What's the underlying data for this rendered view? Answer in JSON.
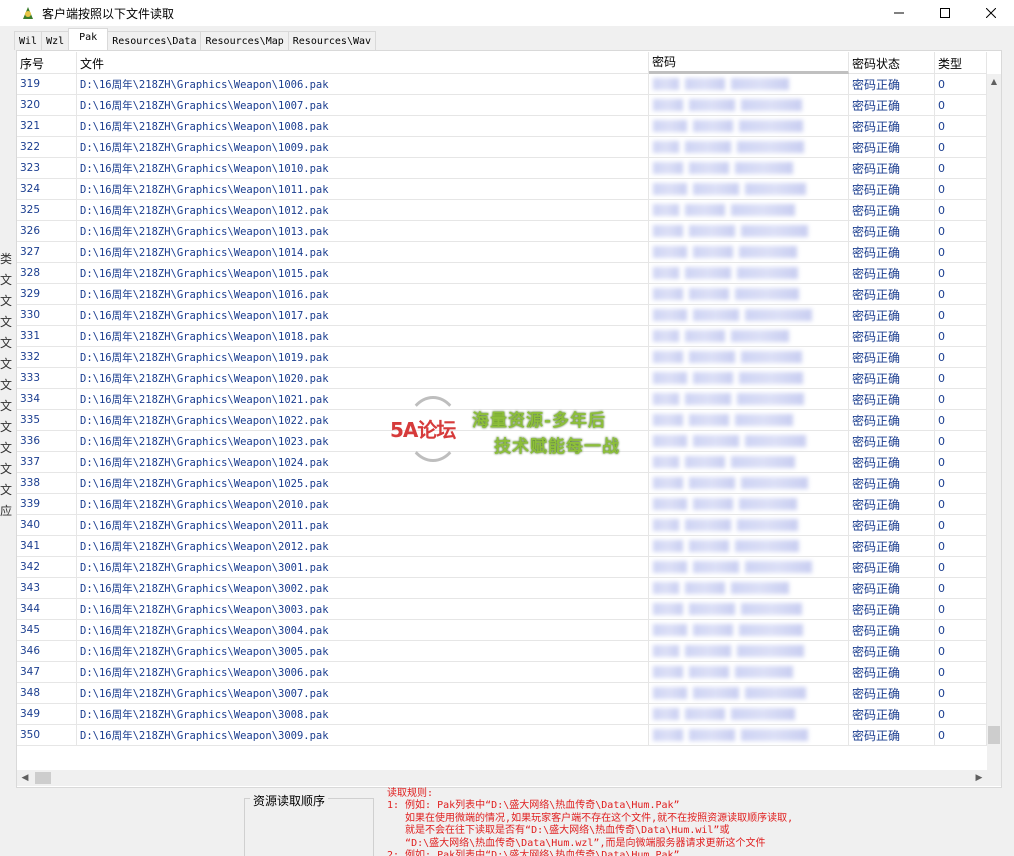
{
  "window": {
    "title": "客户端按照以下文件读取",
    "icon": "app-icon",
    "controls": {
      "minimize": "—",
      "maximize": "☐",
      "close": "✕"
    }
  },
  "tabs": [
    {
      "label": "Wil",
      "active": false
    },
    {
      "label": "Wzl",
      "active": false
    },
    {
      "label": "Pak",
      "active": true
    },
    {
      "label": "Resources\\Data",
      "active": false
    },
    {
      "label": "Resources\\Map",
      "active": false
    },
    {
      "label": "Resources\\Wav",
      "active": false
    }
  ],
  "table": {
    "headers": [
      "序号",
      "文件",
      "密码",
      "密码状态",
      "类型"
    ],
    "rows": [
      {
        "no": "319",
        "file": "D:\\16周年\\218ZH\\Graphics\\Weapon\\1006.pak",
        "status": "密码正确",
        "type": "0"
      },
      {
        "no": "320",
        "file": "D:\\16周年\\218ZH\\Graphics\\Weapon\\1007.pak",
        "status": "密码正确",
        "type": "0"
      },
      {
        "no": "321",
        "file": "D:\\16周年\\218ZH\\Graphics\\Weapon\\1008.pak",
        "status": "密码正确",
        "type": "0"
      },
      {
        "no": "322",
        "file": "D:\\16周年\\218ZH\\Graphics\\Weapon\\1009.pak",
        "status": "密码正确",
        "type": "0"
      },
      {
        "no": "323",
        "file": "D:\\16周年\\218ZH\\Graphics\\Weapon\\1010.pak",
        "status": "密码正确",
        "type": "0"
      },
      {
        "no": "324",
        "file": "D:\\16周年\\218ZH\\Graphics\\Weapon\\1011.pak",
        "status": "密码正确",
        "type": "0"
      },
      {
        "no": "325",
        "file": "D:\\16周年\\218ZH\\Graphics\\Weapon\\1012.pak",
        "status": "密码正确",
        "type": "0"
      },
      {
        "no": "326",
        "file": "D:\\16周年\\218ZH\\Graphics\\Weapon\\1013.pak",
        "status": "密码正确",
        "type": "0"
      },
      {
        "no": "327",
        "file": "D:\\16周年\\218ZH\\Graphics\\Weapon\\1014.pak",
        "status": "密码正确",
        "type": "0"
      },
      {
        "no": "328",
        "file": "D:\\16周年\\218ZH\\Graphics\\Weapon\\1015.pak",
        "status": "密码正确",
        "type": "0"
      },
      {
        "no": "329",
        "file": "D:\\16周年\\218ZH\\Graphics\\Weapon\\1016.pak",
        "status": "密码正确",
        "type": "0"
      },
      {
        "no": "330",
        "file": "D:\\16周年\\218ZH\\Graphics\\Weapon\\1017.pak",
        "status": "密码正确",
        "type": "0"
      },
      {
        "no": "331",
        "file": "D:\\16周年\\218ZH\\Graphics\\Weapon\\1018.pak",
        "status": "密码正确",
        "type": "0"
      },
      {
        "no": "332",
        "file": "D:\\16周年\\218ZH\\Graphics\\Weapon\\1019.pak",
        "status": "密码正确",
        "type": "0"
      },
      {
        "no": "333",
        "file": "D:\\16周年\\218ZH\\Graphics\\Weapon\\1020.pak",
        "status": "密码正确",
        "type": "0"
      },
      {
        "no": "334",
        "file": "D:\\16周年\\218ZH\\Graphics\\Weapon\\1021.pak",
        "status": "密码正确",
        "type": "0"
      },
      {
        "no": "335",
        "file": "D:\\16周年\\218ZH\\Graphics\\Weapon\\1022.pak",
        "status": "密码正确",
        "type": "0"
      },
      {
        "no": "336",
        "file": "D:\\16周年\\218ZH\\Graphics\\Weapon\\1023.pak",
        "status": "密码正确",
        "type": "0"
      },
      {
        "no": "337",
        "file": "D:\\16周年\\218ZH\\Graphics\\Weapon\\1024.pak",
        "status": "密码正确",
        "type": "0"
      },
      {
        "no": "338",
        "file": "D:\\16周年\\218ZH\\Graphics\\Weapon\\1025.pak",
        "status": "密码正确",
        "type": "0"
      },
      {
        "no": "339",
        "file": "D:\\16周年\\218ZH\\Graphics\\Weapon\\2010.pak",
        "status": "密码正确",
        "type": "0"
      },
      {
        "no": "340",
        "file": "D:\\16周年\\218ZH\\Graphics\\Weapon\\2011.pak",
        "status": "密码正确",
        "type": "0"
      },
      {
        "no": "341",
        "file": "D:\\16周年\\218ZH\\Graphics\\Weapon\\2012.pak",
        "status": "密码正确",
        "type": "0"
      },
      {
        "no": "342",
        "file": "D:\\16周年\\218ZH\\Graphics\\Weapon\\3001.pak",
        "status": "密码正确",
        "type": "0"
      },
      {
        "no": "343",
        "file": "D:\\16周年\\218ZH\\Graphics\\Weapon\\3002.pak",
        "status": "密码正确",
        "type": "0"
      },
      {
        "no": "344",
        "file": "D:\\16周年\\218ZH\\Graphics\\Weapon\\3003.pak",
        "status": "密码正确",
        "type": "0"
      },
      {
        "no": "345",
        "file": "D:\\16周年\\218ZH\\Graphics\\Weapon\\3004.pak",
        "status": "密码正确",
        "type": "0"
      },
      {
        "no": "346",
        "file": "D:\\16周年\\218ZH\\Graphics\\Weapon\\3005.pak",
        "status": "密码正确",
        "type": "0"
      },
      {
        "no": "347",
        "file": "D:\\16周年\\218ZH\\Graphics\\Weapon\\3006.pak",
        "status": "密码正确",
        "type": "0"
      },
      {
        "no": "348",
        "file": "D:\\16周年\\218ZH\\Graphics\\Weapon\\3007.pak",
        "status": "密码正确",
        "type": "0"
      },
      {
        "no": "349",
        "file": "D:\\16周年\\218ZH\\Graphics\\Weapon\\3008.pak",
        "status": "密码正确",
        "type": "0"
      },
      {
        "no": "350",
        "file": "D:\\16周年\\218ZH\\Graphics\\Weapon\\3009.pak",
        "status": "密码正确",
        "type": "0"
      }
    ]
  },
  "watermark": {
    "logo": "5A论坛",
    "line1": "海量资源-多年后",
    "line2": "技术赋能每一战"
  },
  "side_glyphs": [
    "类",
    "文",
    "文",
    "文",
    "文",
    "文",
    "文",
    "文",
    "文",
    "文",
    "文",
    "文",
    "应"
  ],
  "bottom": {
    "group_label": "资源读取顺序",
    "rules": [
      "读取规则:",
      "1: 例如: Pak列表中“D:\\盛大网络\\热血传奇\\Data\\Hum.Pak”",
      "   如果在使用微端的情况,如果玩家客户端不存在这个文件,就不在按照资源读取顺序读取,",
      "   就是不会在往下读取是否有“D:\\盛大网络\\热血传奇\\Data\\Hum.wil”或",
      "   “D:\\盛大网络\\热血传奇\\Data\\Hum.wzl”,而是向微端服务器请求更新这个文件",
      "2: 例如: Pak列表中“D:\\盛大网络\\热血传奇\\Data\\Hum.Pak”"
    ]
  },
  "colors": {
    "cell_text": "#1a3d8f",
    "rules_text": "#e02020",
    "watermark_green": "#8dbf3a",
    "watermark_red": "#d63b3b"
  }
}
